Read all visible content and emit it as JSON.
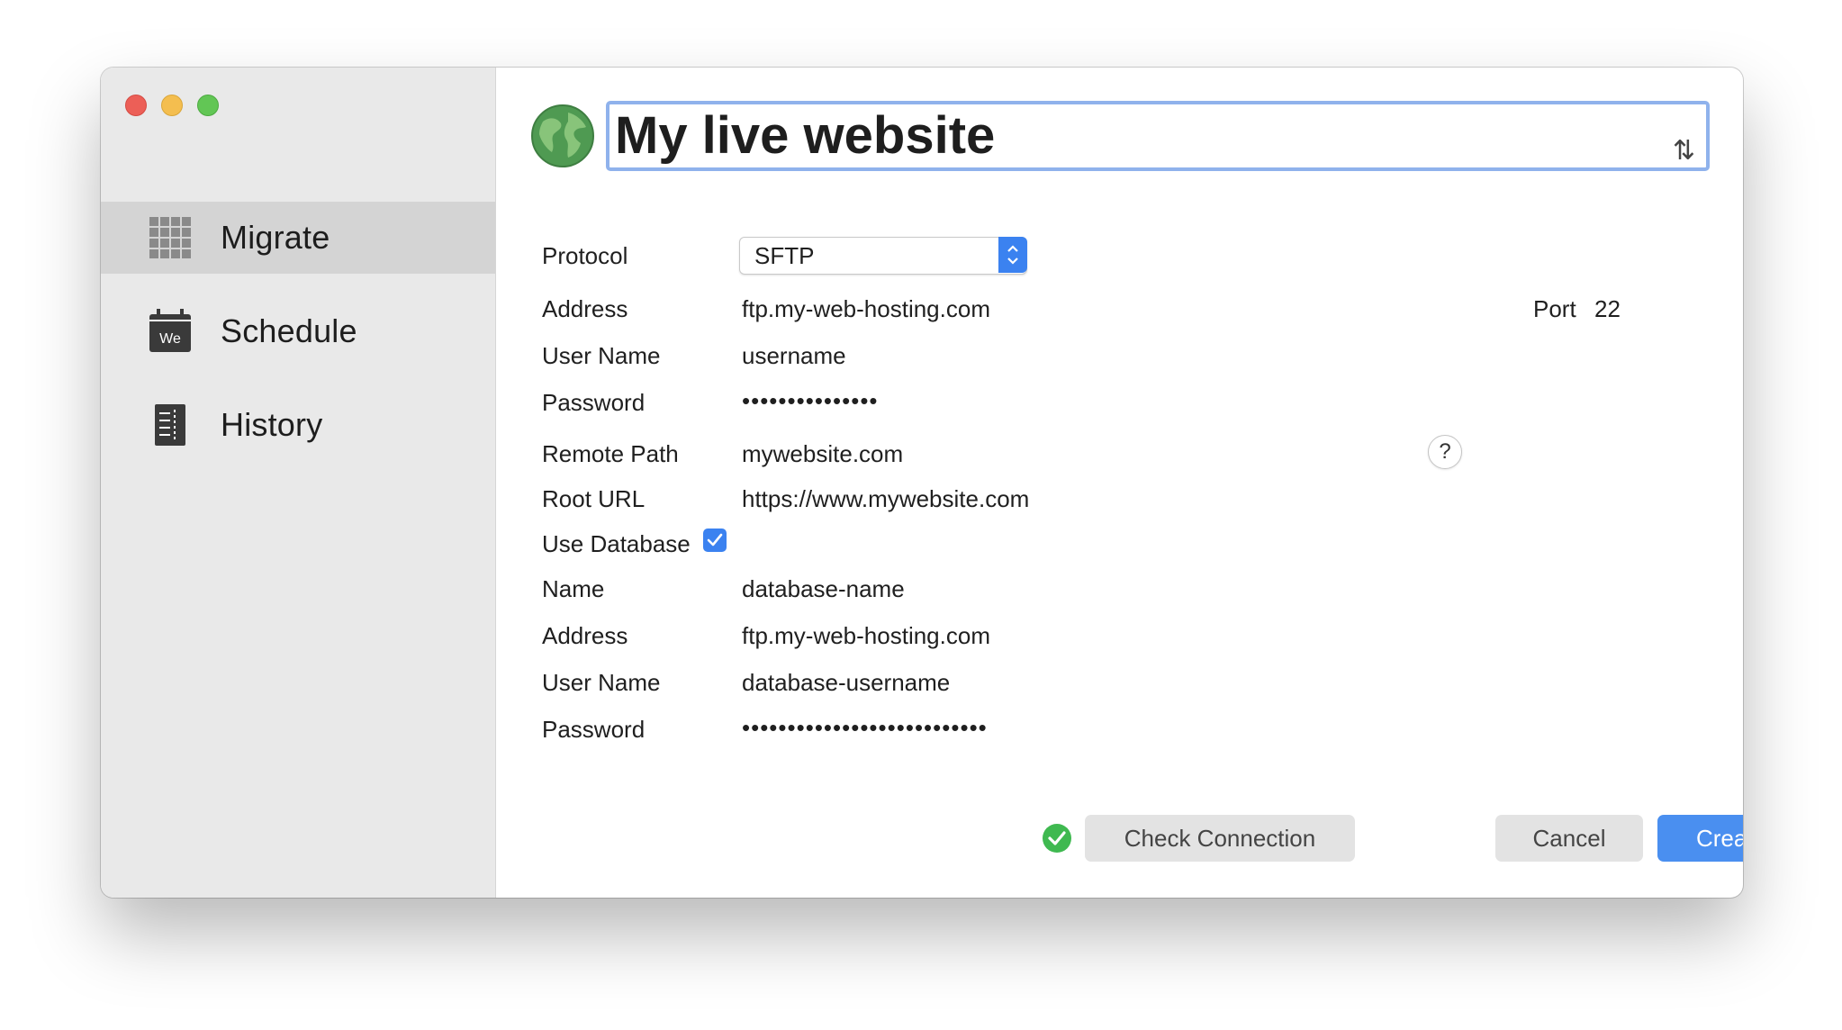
{
  "sidebar": {
    "items": [
      {
        "label": "Migrate",
        "icon": "grid-icon",
        "selected": true
      },
      {
        "label": "Schedule",
        "icon": "calendar-icon",
        "badge": "We",
        "selected": false
      },
      {
        "label": "History",
        "icon": "history-list-icon",
        "selected": false
      }
    ]
  },
  "header": {
    "title": "My live website",
    "icon": "globe-icon"
  },
  "form": {
    "protocol_label": "Protocol",
    "protocol_value": "SFTP",
    "address_label": "Address",
    "address_value": "ftp.my-web-hosting.com",
    "port_label": "Port",
    "port_value": "22",
    "username_label": "User Name",
    "username_value": "username",
    "password_label": "Password",
    "password_value": "•••••••••••••••",
    "remote_path_label": "Remote Path",
    "remote_path_value": "mywebsite.com",
    "help_label": "?",
    "root_url_label": "Root URL",
    "root_url_value": "https://www.mywebsite.com",
    "use_database_label": "Use Database",
    "use_database_checked": true,
    "db_name_label": "Name",
    "db_name_value": "database-name",
    "db_address_label": "Address",
    "db_address_value": "ftp.my-web-hosting.com",
    "db_username_label": "User Name",
    "db_username_value": "database-username",
    "db_password_label": "Password",
    "db_password_value": "•••••••••••••••••••••••••••"
  },
  "footer": {
    "check_connection_label": "Check Connection",
    "connection_status": "ok",
    "cancel_label": "Cancel",
    "create_label": "Create"
  },
  "colors": {
    "accent": "#4a8ff0",
    "sidebar_bg": "#e9e9e9",
    "selected_bg": "#d4d4d4",
    "success": "#3fb950"
  }
}
